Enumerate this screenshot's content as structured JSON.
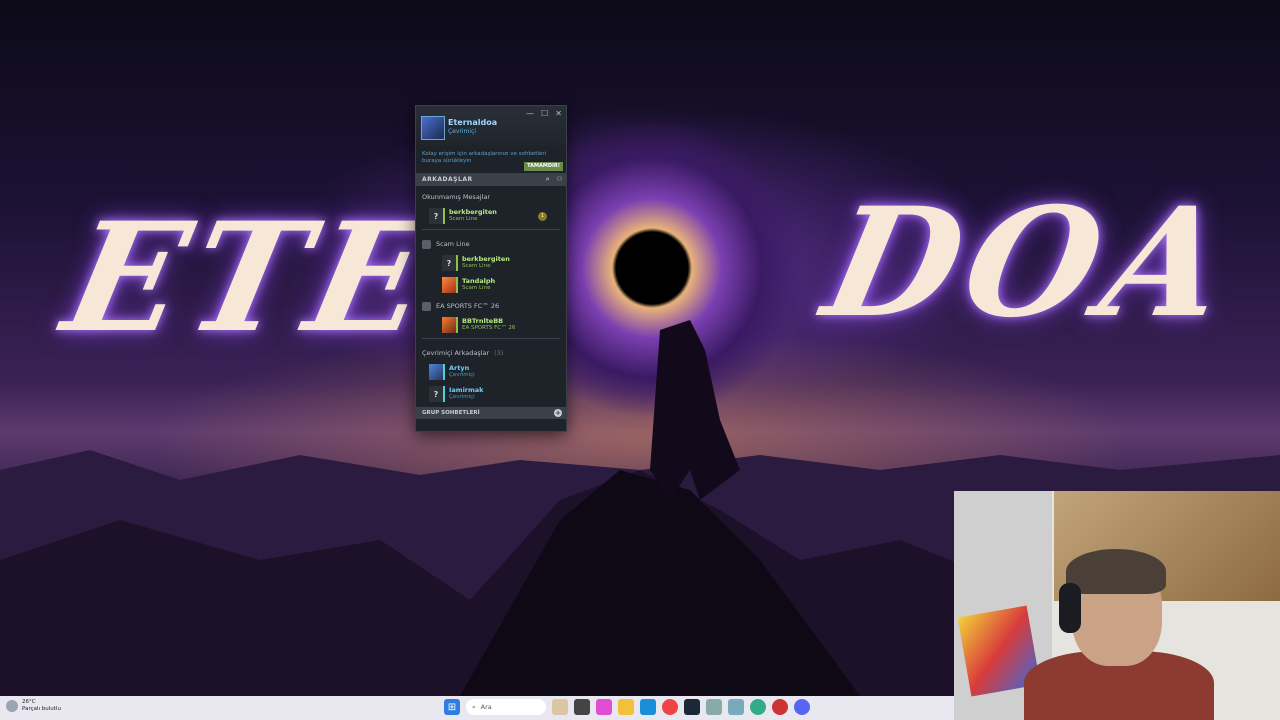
{
  "wallpaper": {
    "text_left": "ETER",
    "text_right": "DOA"
  },
  "friends_window": {
    "user_name": "Eternaldoa",
    "user_status": "Çevrimiçi",
    "hint_text": "Kolay erişim için arkadaşlarınızı ve sohbetleri buraya sürükleyin",
    "hint_button": "TAMAMDIR!",
    "section_friends": "ARKADAŞLAR",
    "unread_title": "Okunmamış Mesajlar",
    "unread": [
      {
        "name": "berkbergiten",
        "status": "Scam Line",
        "badge": "1"
      }
    ],
    "groups": [
      {
        "label": "Scam Line",
        "members": [
          {
            "name": "berkbergiten",
            "status": "Scam Line"
          },
          {
            "name": "Tandalph",
            "status": "Scam Line"
          }
        ]
      },
      {
        "label": "EA SPORTS FC™ 26",
        "members": [
          {
            "name": "BBTrnlteBB",
            "status": "EA SPORTS FC™ 26"
          }
        ]
      }
    ],
    "online_title": "Çevrimiçi Arkadaşlar",
    "online_count": "(3)",
    "online": [
      {
        "name": "Artyn",
        "status": "Çevrimiçi"
      },
      {
        "name": "Iamirmak",
        "status": "Çevrimiçi"
      }
    ],
    "section_group_chats": "GRUP SOHBETLERİ",
    "window_buttons": {
      "minimize": "—",
      "maximize": "☐",
      "close": "✕"
    }
  },
  "taskbar": {
    "weather_temp": "26°C",
    "weather_desc": "Parçalı bulutlu",
    "search_placeholder": "Ara"
  }
}
